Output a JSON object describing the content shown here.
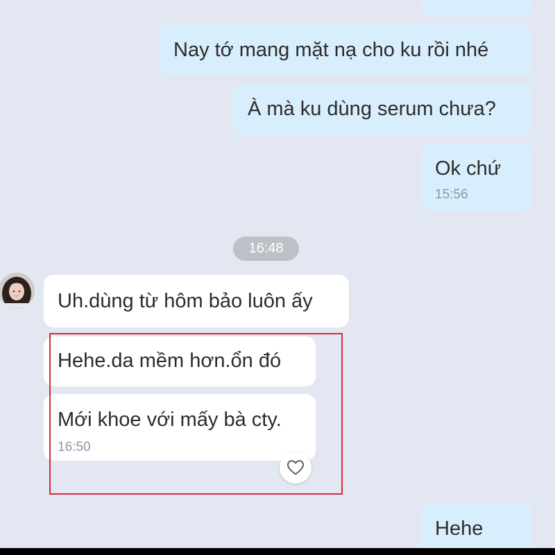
{
  "conversation": {
    "messages": [
      {
        "direction": "outgoing",
        "text": "Nay tớ mang mặt nạ cho ku rồi nhé"
      },
      {
        "direction": "outgoing",
        "text": "À mà ku dùng serum chưa?"
      },
      {
        "direction": "outgoing",
        "text": "Ok chứ",
        "time": "15:56"
      },
      {
        "direction": "incoming",
        "text": "Uh.dùng từ hôm bảo luôn ấy"
      },
      {
        "direction": "incoming",
        "text": "Hehe.da mềm hơn.ổn đó"
      },
      {
        "direction": "incoming",
        "text": "Mới khoe với mấy bà cty.",
        "time": "16:50"
      },
      {
        "direction": "outgoing",
        "text": "Hehe"
      }
    ],
    "divider_time": "16:48"
  },
  "icons": {
    "reaction": "heart-icon",
    "avatar": "contact-avatar"
  },
  "colors": {
    "background": "#e3e7f1",
    "outgoing_bubble": "#d9eefc",
    "incoming_bubble": "#ffffff",
    "highlight_border": "#d6293c",
    "time_text": "#9097a1",
    "divider_pill": "#bcc1c8"
  }
}
